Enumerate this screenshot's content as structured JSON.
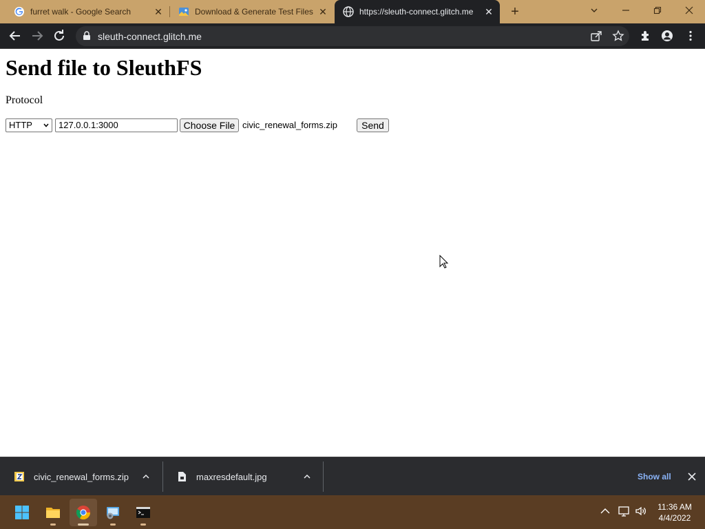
{
  "browser": {
    "tabs": [
      {
        "title": "furret walk - Google Search",
        "favicon": "google-icon",
        "active": false
      },
      {
        "title": "Download & Generate Test Files",
        "favicon": "landscape-icon",
        "active": false
      },
      {
        "title": "https://sleuth-connect.glitch.me",
        "favicon": "globe-icon",
        "active": true
      }
    ],
    "url": "sleuth-connect.glitch.me"
  },
  "page": {
    "heading": "Send file to SleuthFS",
    "protocol_label": "Protocol",
    "protocol_selected": "HTTP",
    "address_value": "127.0.0.1:3000",
    "choose_file_label": "Choose File",
    "chosen_file": "civic_renewal_forms.zip",
    "send_label": "Send"
  },
  "downloads": {
    "items": [
      {
        "name": "civic_renewal_forms.zip",
        "icon": "zip-file-icon"
      },
      {
        "name": "maxresdefault.jpg",
        "icon": "image-file-icon"
      }
    ],
    "show_all_label": "Show all"
  },
  "taskbar": {
    "apps": [
      "windows-start-icon",
      "file-explorer-icon",
      "chrome-icon",
      "remote-desktop-icon",
      "terminal-icon"
    ],
    "time": "11:36 AM",
    "date": "4/4/2022"
  },
  "colors": {
    "tabstrip": "#c9a36b",
    "toolbar": "#202124",
    "taskbar": "#5a3d23",
    "show_all": "#8ab4f8"
  }
}
